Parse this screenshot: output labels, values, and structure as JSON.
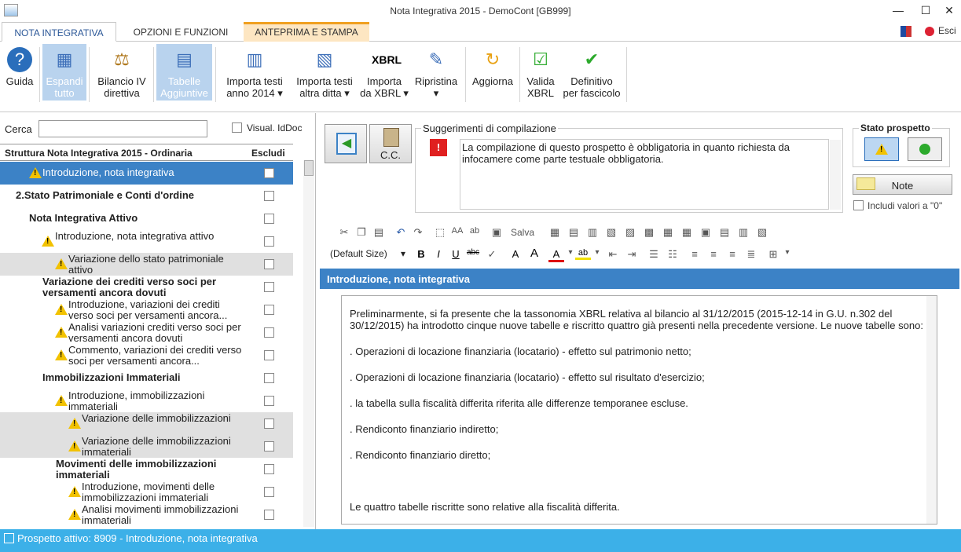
{
  "window": {
    "title": "Nota Integrativa 2015 - DemoCont [GB999]",
    "min": "—",
    "max": "☐",
    "close": "✕"
  },
  "tabs": [
    "NOTA INTEGRATIVA",
    "OPZIONI E FUNZIONI",
    "ANTEPRIMA E STAMPA"
  ],
  "esci_label": "Esci",
  "ribbon": [
    {
      "l1": "Guida",
      "l2": "",
      "icon": "help-icon",
      "glyph": "?"
    },
    {
      "l1": "Espandi",
      "l2": "tutto",
      "icon": "expand-icon",
      "glyph": "▦"
    },
    {
      "l1": "Bilancio IV",
      "l2": "direttiva",
      "icon": "scale-icon",
      "glyph": "⚖"
    },
    {
      "l1": "Tabelle",
      "l2": "Aggiuntive",
      "icon": "tables-icon",
      "glyph": "▤"
    },
    {
      "l1": "Importa testi",
      "l2": "anno 2014 ▾",
      "icon": "import-year-icon",
      "glyph": "▥"
    },
    {
      "l1": "Importa testi",
      "l2": "altra ditta ▾",
      "icon": "import-company-icon",
      "glyph": "▧"
    },
    {
      "l1": "Importa",
      "l2": "da XBRL ▾",
      "icon": "xbrl-icon",
      "glyph": "XBRL"
    },
    {
      "l1": "Ripristina",
      "l2": "▾",
      "icon": "broom-icon",
      "glyph": "✎"
    },
    {
      "l1": "Aggiorna",
      "l2": "",
      "icon": "refresh-icon",
      "glyph": "↻"
    },
    {
      "l1": "Valida",
      "l2": "XBRL",
      "icon": "validate-icon",
      "glyph": "☑"
    },
    {
      "l1": "Definitivo",
      "l2": "per fascicolo",
      "icon": "checkmark-icon",
      "glyph": "✔"
    }
  ],
  "search": {
    "label": "Cerca",
    "value": "",
    "visual_label": "Visual. IdDoc"
  },
  "tree": {
    "header": "Struttura Nota Integrativa 2015 - Ordinaria",
    "exclude_header": "Escludi",
    "rows": [
      {
        "text": "Introduzione, nota integrativa",
        "warn": true
      },
      {
        "text": "2.Stato Patrimoniale e Conti d'ordine",
        "warn": false
      },
      {
        "text": "Nota Integrativa Attivo",
        "warn": false
      },
      {
        "text": "Introduzione, nota integrativa attivo",
        "warn": true
      },
      {
        "text": "Variazione dello stato patrimoniale attivo",
        "warn": true
      },
      {
        "text": "Variazione dei crediti verso soci per versamenti ancora dovuti",
        "warn": false
      },
      {
        "text": "Introduzione, variazioni dei crediti verso soci per versamenti ancora...",
        "warn": true
      },
      {
        "text": "Analisi variazioni crediti verso soci per versamenti ancora dovuti",
        "warn": true
      },
      {
        "text": "Commento, variazioni dei crediti verso soci per versamenti ancora...",
        "warn": true
      },
      {
        "text": "Immobilizzazioni Immateriali",
        "warn": false
      },
      {
        "text": "Introduzione, immobilizzazioni immateriali",
        "warn": true
      },
      {
        "text": "Variazione delle immobilizzazioni",
        "warn": true
      },
      {
        "text": "Variazione delle immobilizzazioni immateriali",
        "warn": true
      },
      {
        "text": "Movimenti delle immobilizzazioni immateriali",
        "warn": false
      },
      {
        "text": "Introduzione, movimenti delle immobilizzazioni immateriali",
        "warn": true
      },
      {
        "text": "Analisi movimenti immobilizzazioni immateriali",
        "warn": true
      }
    ]
  },
  "side": {
    "cc_label": "C.C."
  },
  "suggestions": {
    "label": "Suggerimenti di compilazione",
    "text": "La compilazione di questo prospetto è obbligatoria in quanto richiesta da infocamere come parte testuale obbligatoria."
  },
  "stato": {
    "label": "Stato prospetto",
    "note_label": "Note",
    "include_label": "Includi valori a \"0\""
  },
  "toolbar": {
    "save_label": "Salva",
    "size_label": "(Default Size)"
  },
  "editor": {
    "header": "Introduzione, nota integrativa",
    "paragraphs": [
      "Preliminarmente, si fa presente che la tassonomia XBRL relativa al bilancio al 31/12/2015 (2015-12-14 in G.U. n.302 del 30/12/2015) ha introdotto cinque nuove tabelle e riscritto quattro già presenti nella precedente versione. Le nuove tabelle sono:",
      ". Operazioni di locazione finanziaria (locatario) - effetto sul patrimonio netto;",
      ". Operazioni di locazione finanziaria (locatario) - effetto sul risultato d'esercizio;",
      ". la tabella sulla fiscalità differita riferita alle differenze temporanee escluse.",
      ". Rendiconto finanziario indiretto;",
      ". Rendiconto finanziario diretto;",
      "",
      "Le quattro tabelle riscritte sono relative alla fiscalità differita."
    ]
  },
  "status": "Prospetto attivo: 8909 - Introduzione, nota integrativa"
}
